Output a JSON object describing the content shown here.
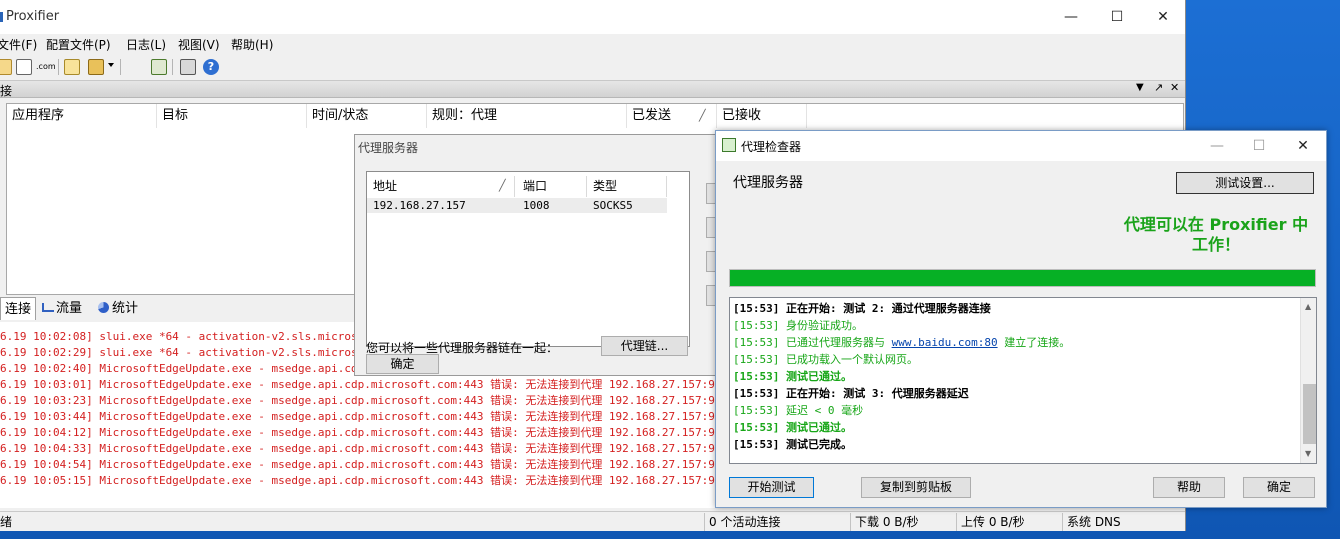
{
  "app": {
    "title": "Proxifier",
    "window_controls": {
      "minimize": "—",
      "maximize": "☐",
      "close": "✕"
    }
  },
  "menu": [
    {
      "label": "文件(F)"
    },
    {
      "label": "配置文件(P)"
    },
    {
      "label": "日志(L)"
    },
    {
      "label": "视图(V)"
    },
    {
      "label": "帮助(H)"
    }
  ],
  "toolbar": {
    "icons": [
      "new-profile-icon",
      "proxy-servers-icon",
      "dns-icon",
      "open-profile-icon",
      "save-profile-icon",
      "dropdown-icon",
      "import-icon",
      "print-icon",
      "help-icon"
    ]
  },
  "connections": {
    "title": "接",
    "header_controls": [
      "▼",
      "↗",
      "✕"
    ],
    "columns": [
      "应用程序",
      "目标",
      "时间/状态",
      "规则：代理",
      "已发送",
      "已接收"
    ],
    "sort_glyph": "╱"
  },
  "tabs": [
    {
      "label": "连接"
    },
    {
      "label": "流量"
    },
    {
      "label": "统计"
    }
  ],
  "log": {
    "lines": [
      "6.19 10:02:08] slui.exe *64 - activation-v2.sls.microsoft.c",
      "6.19 10:02:29] slui.exe *64 - activation-v2.sls.microsoft.c",
      "6.19 10:02:40] MicrosoftEdgeUpdate.exe - msedge.api.cdp.mic",
      "6.19 10:03:01] MicrosoftEdgeUpdate.exe - msedge.api.cdp.microsoft.com:443 错误: 无法连接到代理 192.168.27.157:9999 - 连",
      "6.19 10:03:23] MicrosoftEdgeUpdate.exe - msedge.api.cdp.microsoft.com:443 错误: 无法连接到代理 192.168.27.157:9999 - 连",
      "6.19 10:03:44] MicrosoftEdgeUpdate.exe - msedge.api.cdp.microsoft.com:443 错误: 无法连接到代理 192.168.27.157:9999 - 连",
      "6.19 10:04:12] MicrosoftEdgeUpdate.exe - msedge.api.cdp.microsoft.com:443 错误: 无法连接到代理 192.168.27.157:9999 - 连",
      "6.19 10:04:33] MicrosoftEdgeUpdate.exe - msedge.api.cdp.microsoft.com:443 错误: 无法连接到代理 192.168.27.157:9999 - 连",
      "6.19 10:04:54] MicrosoftEdgeUpdate.exe - msedge.api.cdp.microsoft.com:443 错误: 无法连接到代理 192.168.27.157:9999 - 连",
      "6.19 10:05:15] MicrosoftEdgeUpdate.exe - msedge.api.cdp.microsoft.com:443 错误: 无法连接到代理 192.168.27.157:9999 - 连"
    ]
  },
  "statusbar": {
    "left": "绪",
    "active": "0 个活动连接",
    "download": "下载 0 B/秒",
    "upload": "上传 0 B/秒",
    "dns": "系统 DNS"
  },
  "proxy_dialog": {
    "title": "代理服务器",
    "columns": [
      "地址",
      "端口",
      "类型"
    ],
    "sort_glyph": "╱",
    "rows": [
      {
        "address": "192.168.27.157",
        "port": "1008",
        "type": "SOCKS5"
      }
    ],
    "chain_text": "您可以将一些代理服务器链在一起：",
    "chain_button": "代理链...",
    "ok_button": "确定"
  },
  "checker": {
    "title": "代理检查器",
    "heading": "代理服务器",
    "test_settings_button": "测试设置...",
    "result_line1": "代理可以在 Proxifier 中",
    "result_line2": "工作！",
    "progress": 1.0,
    "log": [
      {
        "style": "bold",
        "text": "[15:53] 正在开始: 测试 2: 通过代理服务器连接"
      },
      {
        "style": "green",
        "text": "[15:53] 身份验证成功。"
      },
      {
        "style": "link",
        "before": "[15:53] 已通过代理服务器与 ",
        "link": "www.baidu.com:80",
        "after": " 建立了连接。"
      },
      {
        "style": "green",
        "text": "[15:53] 已成功载入一个默认网页。"
      },
      {
        "style": "green-bold",
        "text": "[15:53] 测试已通过。"
      },
      {
        "style": "bold",
        "text": "[15:53] 正在开始: 测试 3: 代理服务器延迟"
      },
      {
        "style": "green",
        "text": "[15:53] 延迟 < 0 毫秒"
      },
      {
        "style": "green-bold",
        "text": "[15:53] 测试已通过。"
      },
      {
        "style": "bold",
        "text": "[15:53] 测试已完成。"
      }
    ],
    "buttons": {
      "start": "开始测试",
      "copy": "复制到剪贴板",
      "help": "帮助",
      "ok": "确定"
    },
    "colors": {
      "success": "#17a617",
      "progress": "#06b025"
    }
  }
}
